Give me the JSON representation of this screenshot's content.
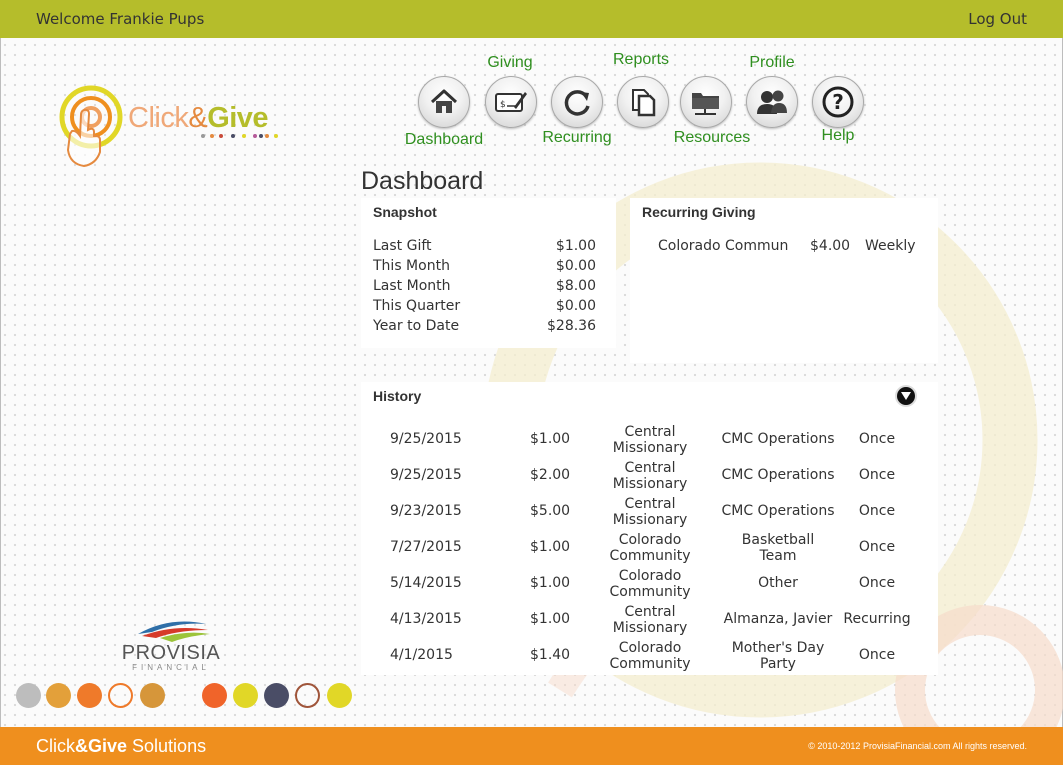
{
  "header": {
    "welcome": "Welcome Frankie Pups",
    "logout": "Log Out"
  },
  "logo": {
    "part1": "Click",
    "amp": "&",
    "part2": "Give"
  },
  "nav": [
    {
      "label": "Dashboard",
      "icon": "home-icon"
    },
    {
      "label": "Giving",
      "icon": "check-pen-icon"
    },
    {
      "label": "Recurring",
      "icon": "refresh-icon"
    },
    {
      "label": "Reports",
      "icon": "documents-icon"
    },
    {
      "label": "Resources",
      "icon": "folder-network-icon"
    },
    {
      "label": "Profile",
      "icon": "users-icon"
    },
    {
      "label": "Help",
      "icon": "help-icon"
    }
  ],
  "page": {
    "title": "Dashboard"
  },
  "snapshot": {
    "heading": "Snapshot",
    "rows": [
      {
        "label": "Last Gift",
        "value": "$1.00"
      },
      {
        "label": "This Month",
        "value": "$0.00"
      },
      {
        "label": "Last Month",
        "value": "$8.00"
      },
      {
        "label": "This Quarter",
        "value": "$0.00"
      },
      {
        "label": "Year to Date",
        "value": "$28.36"
      }
    ]
  },
  "recurring": {
    "heading": "Recurring Giving",
    "rows": [
      {
        "name": "Colorado Commun",
        "amount": "$4.00",
        "frequency": "Weekly"
      }
    ]
  },
  "history": {
    "heading": "History",
    "rows": [
      {
        "date": "9/25/2015",
        "amount": "$1.00",
        "org1": "Central",
        "org2": "Missionary",
        "fund1": "CMC Operations",
        "fund2": "",
        "type": "Once"
      },
      {
        "date": "9/25/2015",
        "amount": "$2.00",
        "org1": "Central",
        "org2": "Missionary",
        "fund1": "CMC Operations",
        "fund2": "",
        "type": "Once"
      },
      {
        "date": "9/23/2015",
        "amount": "$5.00",
        "org1": "Central",
        "org2": "Missionary",
        "fund1": "CMC Operations",
        "fund2": "",
        "type": "Once"
      },
      {
        "date": "7/27/2015",
        "amount": "$1.00",
        "org1": "Colorado",
        "org2": "Community",
        "fund1": "Basketball",
        "fund2": "Team",
        "type": "Once"
      },
      {
        "date": "5/14/2015",
        "amount": "$1.00",
        "org1": "Colorado",
        "org2": "Community",
        "fund1": "Other",
        "fund2": "",
        "type": "Once"
      },
      {
        "date": "4/13/2015",
        "amount": "$1.00",
        "org1": "Central",
        "org2": "Missionary",
        "fund1": "Almanza, Javier",
        "fund2": "",
        "type": "Recurring"
      },
      {
        "date": "4/1/2015",
        "amount": "$1.40",
        "org1": "Colorado",
        "org2": "Community",
        "fund1": "Mother's Day",
        "fund2": "Party",
        "type": "Once"
      }
    ]
  },
  "partner": {
    "name": "PROVISIA",
    "sub": "FINANCIAL"
  },
  "footer": {
    "brand1": "Click",
    "brand2": "&Give",
    "brand3": " Solutions",
    "copyright": "© 2010-2012 ProvisiaFinancial.com   All rights reserved."
  },
  "colors": {
    "topbar": "#b5bd2b",
    "footer": "#ef8f1e",
    "nav_label": "#2f8f1f",
    "decor_dots": [
      "#bdbdbd",
      "#e3a03a",
      "#ef7a2a",
      "outline-orange",
      "#d6963a",
      "#f0642a",
      "#e1d727",
      "#4a4d66",
      "outline-brown",
      "#e1d727"
    ]
  }
}
